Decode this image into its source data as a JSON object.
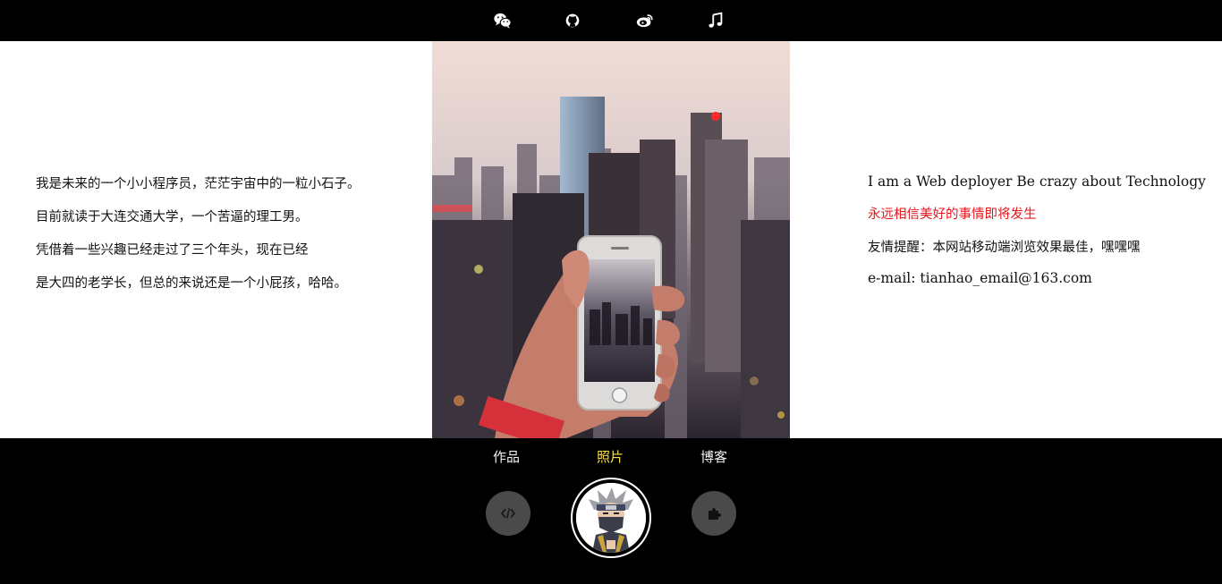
{
  "top_bar": {
    "icons": [
      "wechat-icon",
      "github-icon",
      "weibo-icon",
      "music-icon"
    ]
  },
  "intro_cn": {
    "lines": [
      "我是未来的一个小小程序员，茫茫宇宙中的一粒小石子。",
      "目前就读于大连交通大学，一个苦逼的理工男。",
      "凭借着一些兴趣已经走过了三个年头，现在已经",
      "是大四的老学长，但总的来说还是一个小屁孩，哈哈。"
    ]
  },
  "intro_en": {
    "tagline": "I am a Web deployer Be crazy about Technology",
    "motto": "永远相信美好的事情即将发生",
    "tip": "友情提醒：本网站移动端浏览效果最佳，嘿嘿嘿",
    "email": "e-mail: tianhao_email@163.com"
  },
  "bottom_nav": {
    "items": [
      {
        "label": "作品",
        "active": false
      },
      {
        "label": "照片",
        "active": true
      },
      {
        "label": "博客",
        "active": false
      }
    ],
    "buttons": [
      "code-icon",
      "avatar",
      "puzzle-icon"
    ]
  },
  "colors": {
    "bar_bg": "#000000",
    "active_tab": "#f7e24a",
    "motto": "#e8141b",
    "button_bg": "#4a4a4a"
  }
}
